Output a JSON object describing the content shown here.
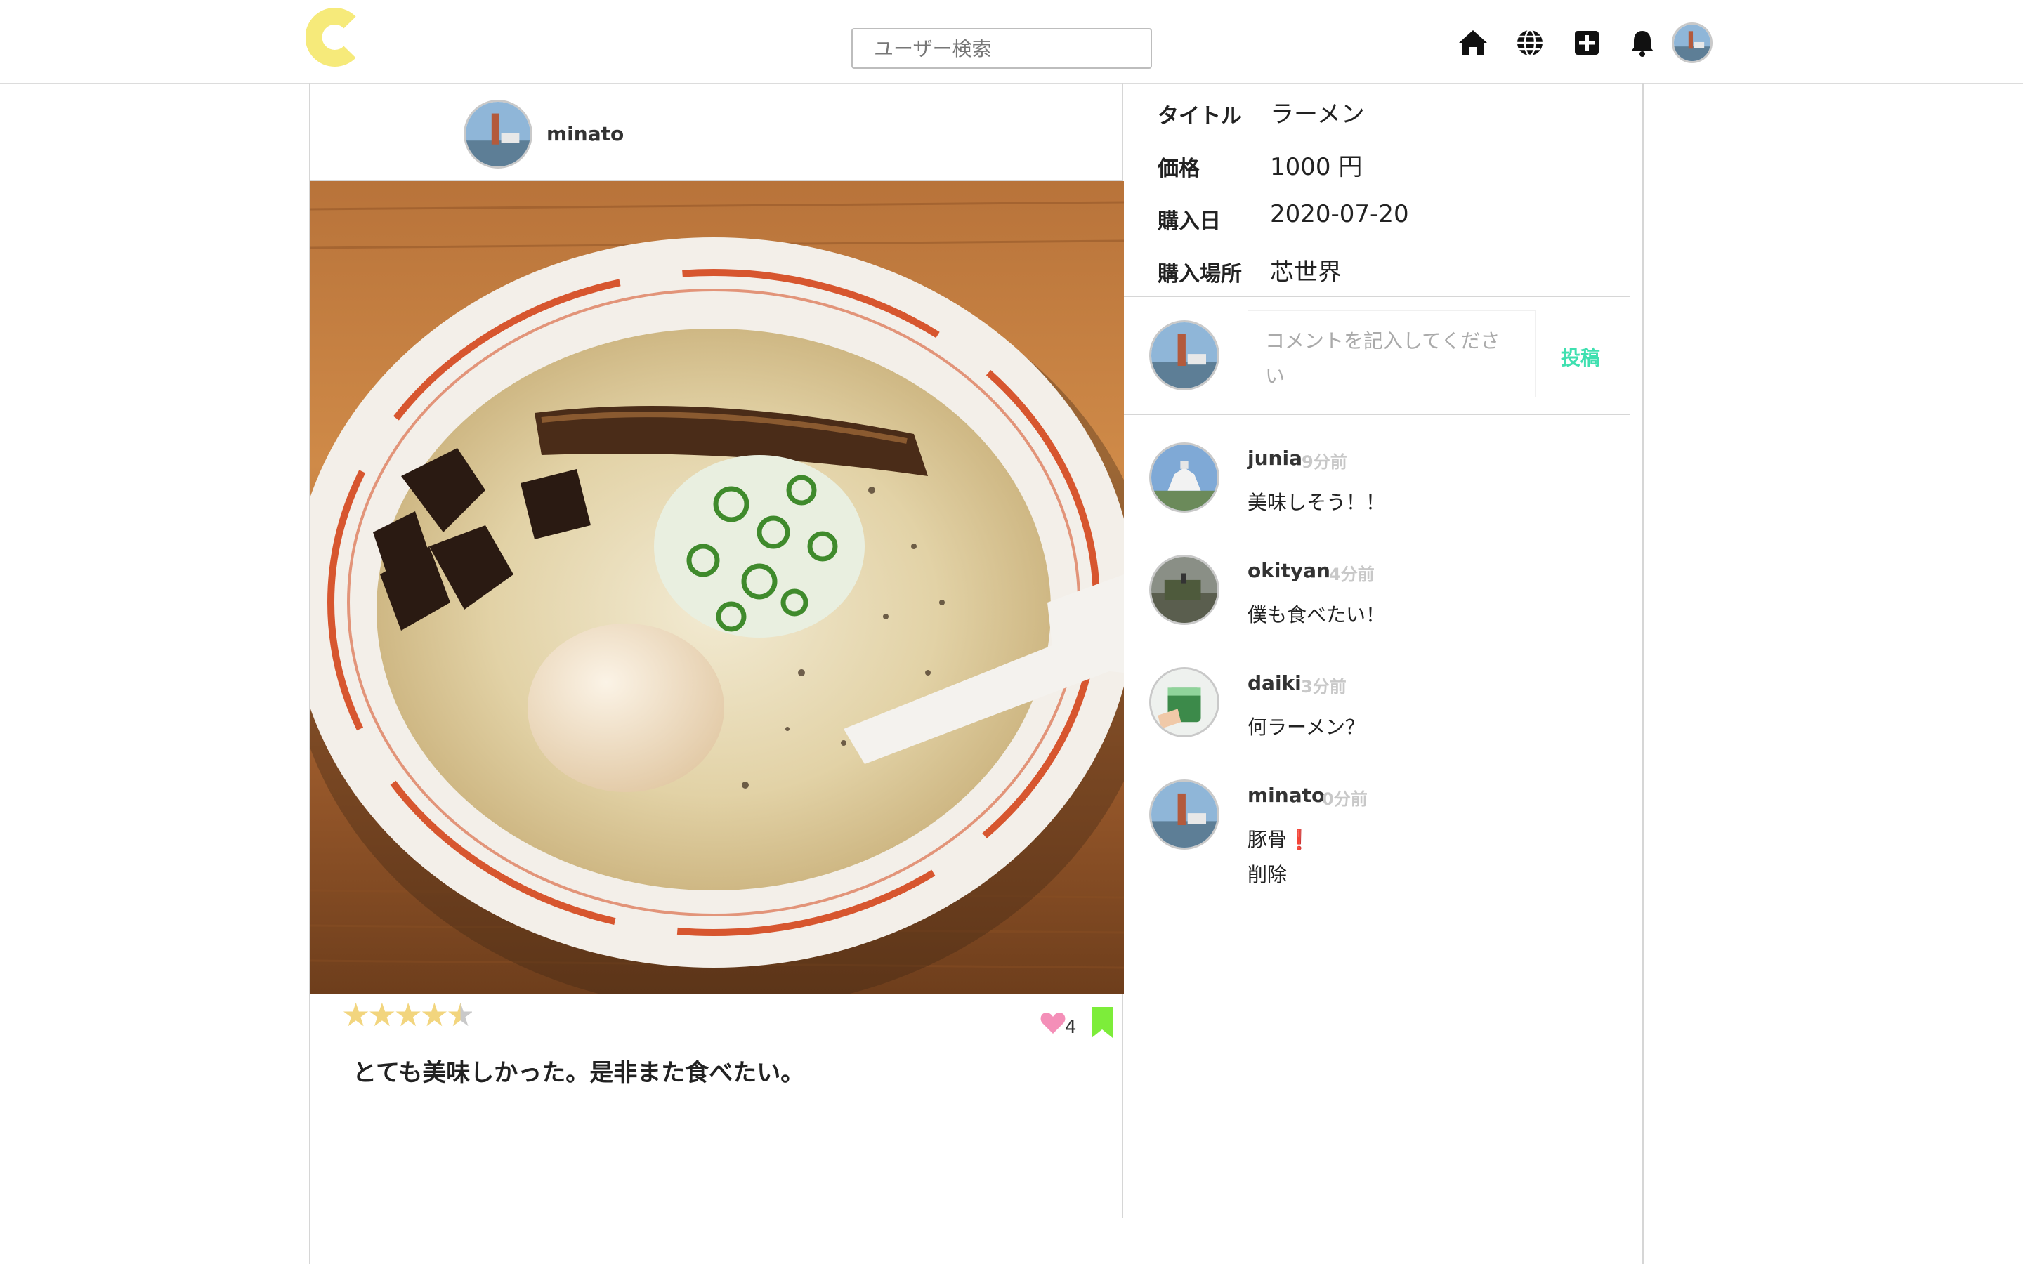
{
  "header": {
    "search_placeholder": "ユーザー検索",
    "logo_color": "#f6ea7a",
    "icons": [
      "home-icon",
      "globe-icon",
      "plus-square-icon",
      "bell-icon"
    ]
  },
  "post": {
    "username": "minato",
    "rating": 4.5,
    "rating_max": 5,
    "likes": "4",
    "description": "とても美味しかった。是非また食べたい。",
    "details": [
      {
        "label": "タイトル",
        "value": "ラーメン"
      },
      {
        "label": "価格",
        "value": "1000 円"
      },
      {
        "label": "購入日",
        "value": "2020-07-20"
      },
      {
        "label": "購入場所",
        "value": "芯世界"
      }
    ]
  },
  "comment_form": {
    "placeholder": "コメントを記入してください",
    "submit_label": "投稿",
    "submit_color": "#3fe0b0"
  },
  "comments": [
    {
      "user": "junia",
      "time": "9分前",
      "text": "美味しそう！！"
    },
    {
      "user": "okityan",
      "time": "4分前",
      "text": "僕も食べたい！"
    },
    {
      "user": "daiki",
      "time": "3分前",
      "text": "何ラーメン？"
    },
    {
      "user": "minato",
      "time": "0分前",
      "text": "豚骨",
      "delete_label": "削除"
    }
  ]
}
